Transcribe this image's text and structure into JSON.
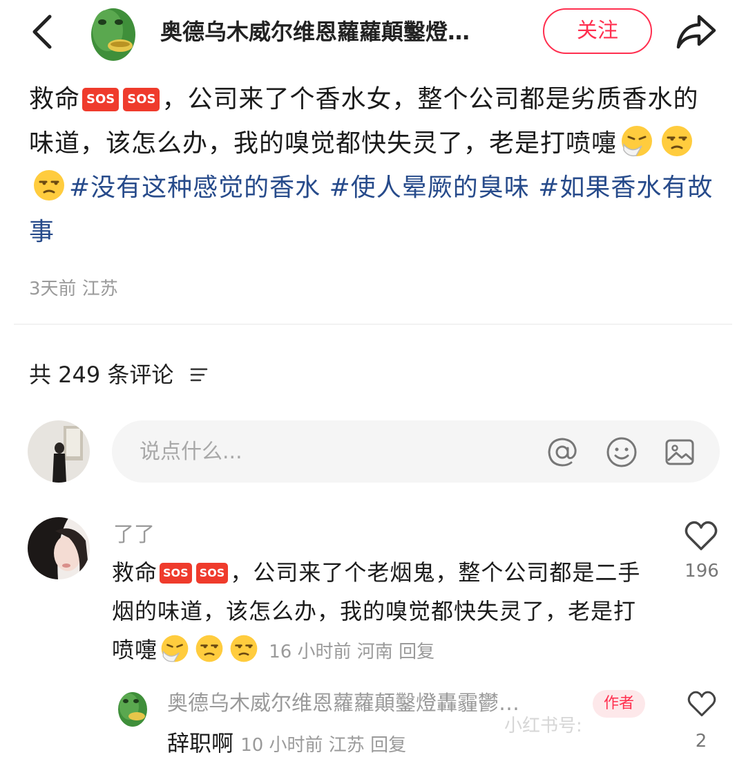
{
  "header": {
    "author_name": "奥德乌木威尔维恩蘿蘿顛鑿燈…",
    "follow_label": "关注",
    "icons": [
      "back-arrow-icon",
      "frog-mask-avatar",
      "share-icon"
    ],
    "accent_color": "#ff2f4f"
  },
  "post": {
    "text_before": "救命",
    "sos_badge": "SOS",
    "text_after": "，公司来了个香水女，整个公司都是劣质香水的味道，该怎么办，我的嗅觉都快失灵了，老是打喷嚏",
    "emojis": [
      "sneezing-face-emoji",
      "unamused-face-emoji",
      "unamused-face-emoji"
    ],
    "hashtags": [
      "#没有这种感觉的香水",
      "#使人晕厥的臭味",
      "#如果香水有故事"
    ],
    "meta": "3天前 江苏"
  },
  "comments_header": {
    "count_label": "共 249 条评论"
  },
  "comment_input": {
    "placeholder": "说点什么..."
  },
  "comments": [
    {
      "name": "了了",
      "text_before": "救命",
      "sos_badge": "SOS",
      "text_after": "，公司来了个老烟鬼，整个公司都是二手烟的味道，该怎么办，我的嗅觉都快失灵了，老是打喷嚏",
      "meta": "16 小时前 河南 回复",
      "likes": "196",
      "replies": [
        {
          "name": "奥德乌木威尔维恩蘿蘿顛鑿燈轟霾鬱…",
          "badge": "作者",
          "text": "辞职啊",
          "meta": "10 小时前 江苏 回复",
          "likes": "2"
        }
      ]
    }
  ],
  "watermark": "小红书号:"
}
